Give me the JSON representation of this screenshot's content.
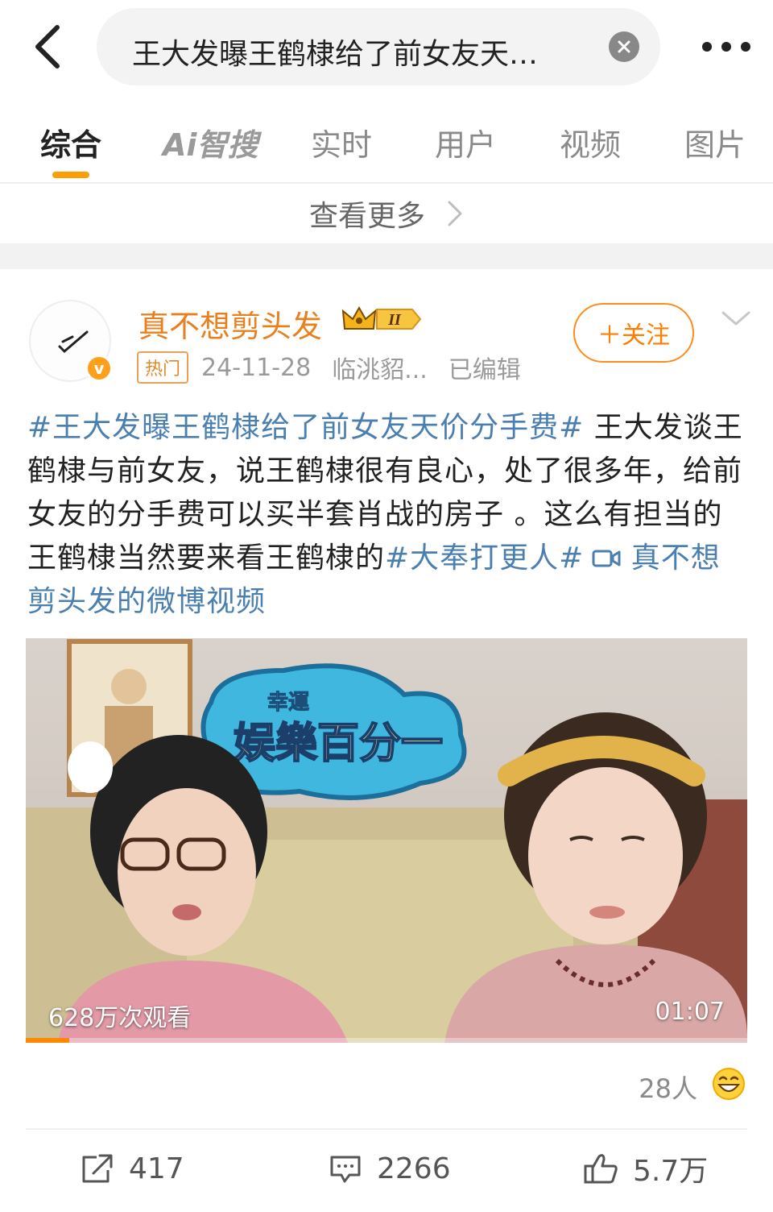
{
  "search": {
    "query": "王大发曝王鹤棣给了前女友天…"
  },
  "tabs": [
    {
      "label": "综合"
    },
    {
      "label": "Ai智搜"
    },
    {
      "label": "实时"
    },
    {
      "label": "用户"
    },
    {
      "label": "视频"
    },
    {
      "label": "图片"
    }
  ],
  "see_more": "查看更多",
  "post": {
    "username": "真不想剪头发",
    "level_badge": "II",
    "avatar_badge": "v",
    "hot_tag": "热门",
    "date": "24-11-28",
    "location": "临洮貂...",
    "edited": "已编辑",
    "follow_label": "＋关注",
    "body": {
      "tag1": "#王大发曝王鹤棣给了前女友天价分手费#",
      "text": " 王大发谈王鹤棣与前女友，说王鹤棣很有良心，处了很多年，给前女友的分手费可以买半套肖战的房子 。这么有担当的王鹤棣当然要来看王鹤棣的",
      "tag2": "#大奉打更人#",
      "video_link": " 真不想剪头发的微博视频"
    },
    "video": {
      "views": "628万次观看",
      "duration": "01:07",
      "logo_text": "娱樂百分一",
      "logo_sub": "幸運",
      "progress": 0.06
    },
    "reactors": "28人",
    "actions": {
      "reposts": "417",
      "comments": "2266",
      "likes": "5.7万"
    }
  }
}
